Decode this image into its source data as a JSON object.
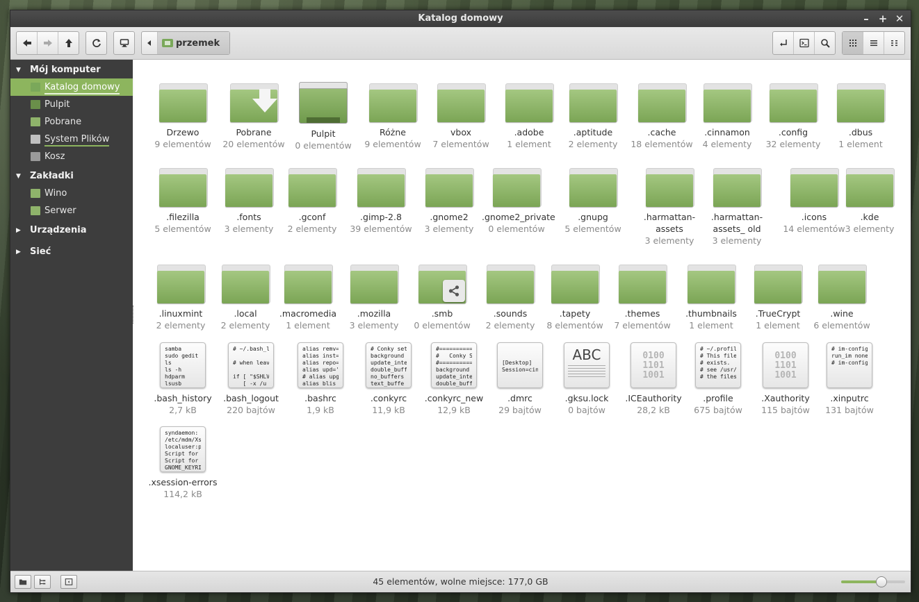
{
  "window": {
    "title": "Katalog domowy"
  },
  "toolbar": {
    "location_label": "przemek"
  },
  "sidebar": {
    "sections": [
      {
        "title": "Mój komputer",
        "expanded": true,
        "items": [
          {
            "label": "Katalog domowy",
            "icon": "home-folder-icon",
            "selected": true,
            "bar": true
          },
          {
            "label": "Pulpit",
            "icon": "desktop-icon",
            "selected": false,
            "bar": false
          },
          {
            "label": "Pobrane",
            "icon": "downloads-folder-icon",
            "selected": false,
            "bar": false
          },
          {
            "label": "System Plików",
            "icon": "drive-icon",
            "selected": false,
            "bar": true
          },
          {
            "label": "Kosz",
            "icon": "trash-icon",
            "selected": false,
            "bar": false
          }
        ]
      },
      {
        "title": "Zakładki",
        "expanded": true,
        "items": [
          {
            "label": "Wino",
            "icon": "folder-icon",
            "selected": false,
            "bar": false
          },
          {
            "label": "Serwer",
            "icon": "network-folder-icon",
            "selected": false,
            "bar": false
          }
        ]
      },
      {
        "title": "Urządzenia",
        "expanded": false,
        "items": []
      },
      {
        "title": "Sieć",
        "expanded": false,
        "items": []
      }
    ]
  },
  "files": [
    {
      "name": "Drzewo",
      "meta": "9 elementów",
      "kind": "folder"
    },
    {
      "name": "Pobrane",
      "meta": "20 elementów",
      "kind": "downloads"
    },
    {
      "name": "Pulpit",
      "meta": "0 elementów",
      "kind": "desktop"
    },
    {
      "name": "Różne",
      "meta": "9 elementów",
      "kind": "folder"
    },
    {
      "name": "vbox",
      "meta": "7 elementów",
      "kind": "folder"
    },
    {
      "name": ".adobe",
      "meta": "1 element",
      "kind": "folder"
    },
    {
      "name": ".aptitude",
      "meta": "2 elementy",
      "kind": "folder"
    },
    {
      "name": ".cache",
      "meta": "18 elementów",
      "kind": "folder"
    },
    {
      "name": ".cinnamon",
      "meta": "4 elementy",
      "kind": "folder"
    },
    {
      "name": ".config",
      "meta": "32 elementy",
      "kind": "folder"
    },
    {
      "name": ".dbus",
      "meta": "1 element",
      "kind": "folder"
    },
    {
      "name": ".filezilla",
      "meta": "5 elementów",
      "kind": "folder"
    },
    {
      "name": ".fonts",
      "meta": "3 elementy",
      "kind": "folder"
    },
    {
      "name": ".gconf",
      "meta": "2 elementy",
      "kind": "folder"
    },
    {
      "name": ".gimp-2.8",
      "meta": "39 elementów",
      "kind": "folder"
    },
    {
      "name": ".gnome2",
      "meta": "3 elementy",
      "kind": "folder"
    },
    {
      "name": ".gnome2_private",
      "meta": "0 elementów",
      "kind": "folder"
    },
    {
      "name": ".gnupg",
      "meta": "5 elementów",
      "kind": "folder"
    },
    {
      "name": ".harmattan-assets",
      "meta": "3 elementy",
      "kind": "folder"
    },
    {
      "name": ".harmattan-assets_ old",
      "meta": "3 elementy",
      "kind": "folder"
    },
    {
      "name": ".icons",
      "meta": "14 elementów",
      "kind": "folder"
    },
    {
      "name": ".kde",
      "meta": "3 elementy",
      "kind": "folder"
    },
    {
      "name": ".linuxmint",
      "meta": "2 elementy",
      "kind": "folder"
    },
    {
      "name": ".local",
      "meta": "2 elementy",
      "kind": "folder"
    },
    {
      "name": ".macromedia",
      "meta": "1 element",
      "kind": "folder"
    },
    {
      "name": ".mozilla",
      "meta": "3 elementy",
      "kind": "folder"
    },
    {
      "name": ".smb",
      "meta": "0 elementów",
      "kind": "shared"
    },
    {
      "name": ".sounds",
      "meta": "2 elementy",
      "kind": "folder"
    },
    {
      "name": ".tapety",
      "meta": "8 elementów",
      "kind": "folder"
    },
    {
      "name": ".themes",
      "meta": "7 elementów",
      "kind": "folder"
    },
    {
      "name": ".thumbnails",
      "meta": "1 element",
      "kind": "folder"
    },
    {
      "name": ".TrueCrypt",
      "meta": "1 element",
      "kind": "folder"
    },
    {
      "name": ".wine",
      "meta": "6 elementów",
      "kind": "folder"
    },
    {
      "name": ".bash_history",
      "meta": "2,7 kB",
      "kind": "text",
      "preview": "samba\nsudo gedit\nls\nls -h\nhdparm\nlsusb"
    },
    {
      "name": ".bash_logout",
      "meta": "220 bajtów",
      "kind": "text",
      "preview": "# ~/.bash_l\n\n# when leav\n\nif [ \"$SHLV\n   [ -x /u"
    },
    {
      "name": ".bashrc",
      "meta": "1,9 kB",
      "kind": "text",
      "preview": "alias remv=\nalias inst=\nalias repo=\nalias upd='\n# alias upg\nalias blis"
    },
    {
      "name": ".conkyrc",
      "meta": "11,9 kB",
      "kind": "text",
      "preview": "# Conky set\nbackground\nupdate_inte\ndouble_buff\nno_buffers\ntext_buffe"
    },
    {
      "name": ".conkyrc_new",
      "meta": "12,9 kB",
      "kind": "text",
      "preview": "#==========\n#   Conky S\n#==========\nbackground\nupdate_inte\ndouble_buff"
    },
    {
      "name": ".dmrc",
      "meta": "29 bajtów",
      "kind": "text",
      "preview": "\n\n[Desktop]\nSession=cin"
    },
    {
      "name": ".gksu.lock",
      "meta": "0 bajtów",
      "kind": "abc",
      "preview": "ABC"
    },
    {
      "name": ".ICEauthority",
      "meta": "28,2 kB",
      "kind": "binary",
      "preview": "0100\n1101\n1001"
    },
    {
      "name": ".profile",
      "meta": "675 bajtów",
      "kind": "text",
      "preview": "# ~/.profil\n# This file\n# exists.\n# see /usr/\n# the files"
    },
    {
      "name": ".Xauthority",
      "meta": "115 bajtów",
      "kind": "binary",
      "preview": "0100\n1101\n1001"
    },
    {
      "name": ".xinputrc",
      "meta": "131 bajtów",
      "kind": "text",
      "preview": "# im-config\nrun_im none\n# im-config"
    },
    {
      "name": ".xsession-errors",
      "meta": "114,2 kB",
      "kind": "text",
      "preview": "syndaemon:\n/etc/mdm/Xs\nlocaluser:p\nScript for\nScript for\nGNOME_KEYRI"
    }
  ],
  "status": {
    "text": "45 elementów, wolne miejsce: 177,0 GB",
    "zoom_fraction": 0.62
  },
  "colors": {
    "accent": "#8db55e",
    "folder": "#7ba555",
    "sidebar": "#3d3d3d"
  }
}
